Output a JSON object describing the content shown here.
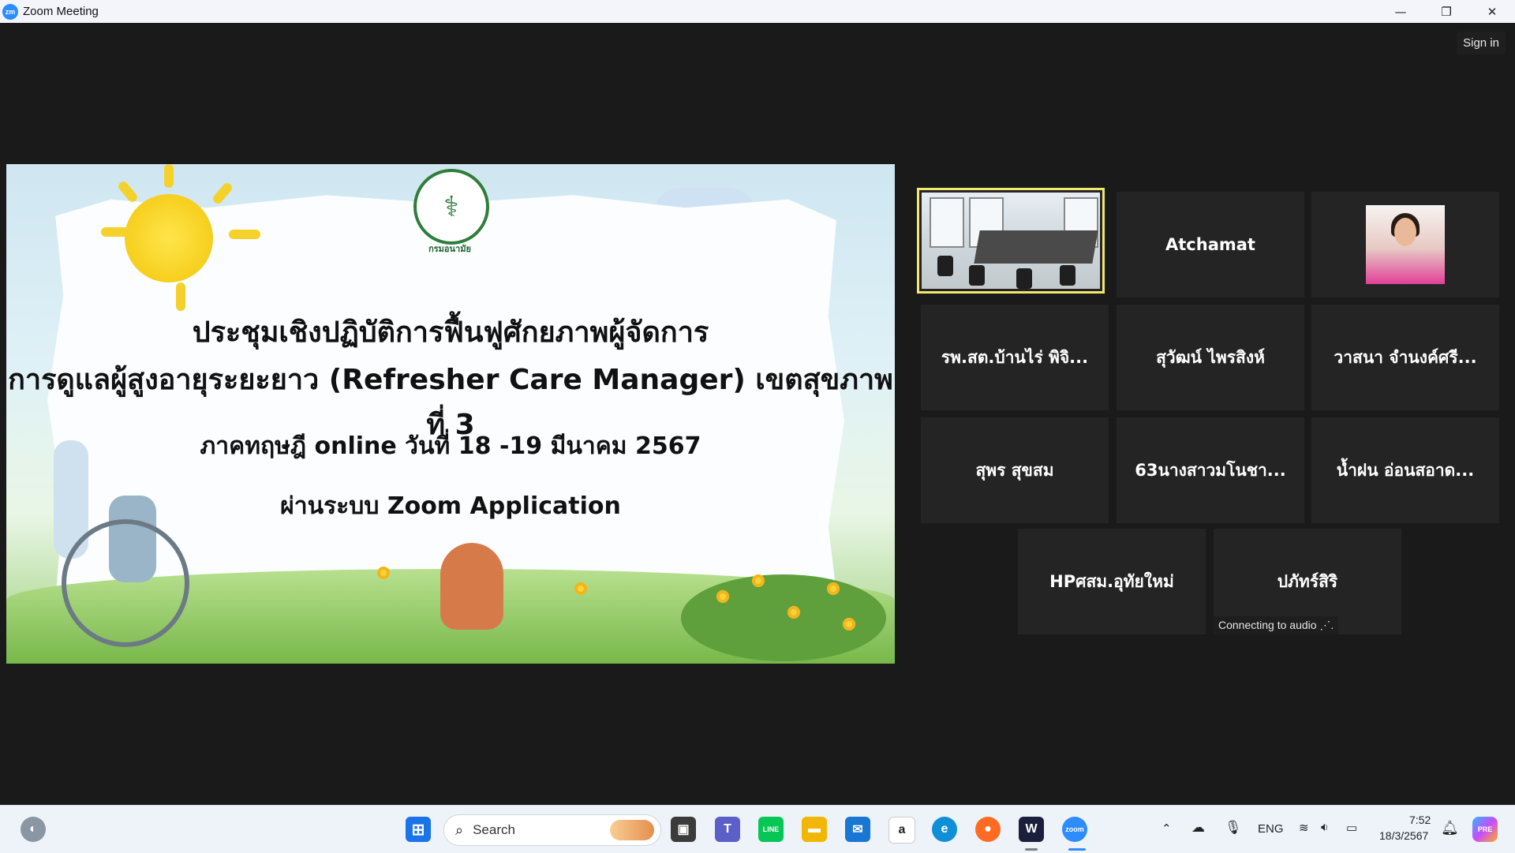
{
  "window": {
    "title": "Zoom Meeting",
    "app_icon_text": "zm",
    "controls": {
      "minimize": "—",
      "restore": "❐",
      "close": "✕"
    }
  },
  "meeting": {
    "sign_in_label": "Sign in"
  },
  "slide": {
    "logo_caption": "กรมอนามัย",
    "line1": "ประชุมเชิงปฏิบัติการฟื้นฟูศักยภาพผู้จัดการ",
    "line2": "การดูแลผู้สูงอายุระยะยาว (Refresher Care Manager) เขตสุขภาพที่ 3",
    "line3": "ภาคทฤษฎี online วันที่ 18 -19 มีนาคม 2567",
    "line4": "ผ่านระบบ Zoom Application"
  },
  "participants": [
    {
      "name": "",
      "type": "camera-room",
      "active": true
    },
    {
      "name": "Atchamat",
      "type": "name"
    },
    {
      "name": "",
      "type": "photo"
    },
    {
      "name": "รพ.สต.บ้านไร่ พิจิ...",
      "type": "name"
    },
    {
      "name": "สุวัฒน์ ไพรสิงห์",
      "type": "name"
    },
    {
      "name": "วาสนา  จำนงค์ศรี...",
      "type": "name"
    },
    {
      "name": "สุพร สุขสม",
      "type": "name"
    },
    {
      "name": "63นางสาวมโนชา...",
      "type": "name"
    },
    {
      "name": "น้ำฝน อ่อนสอาด...",
      "type": "name"
    },
    {
      "name": "HPศสม.อุทัยใหม่",
      "type": "name"
    },
    {
      "name": "ปภัทร์สิริ",
      "type": "name",
      "status": "Connecting to audio ⋰."
    }
  ],
  "taskbar": {
    "search_placeholder": "Search",
    "tray": {
      "language": "ENG",
      "time": "7:52",
      "date": "18/3/2567"
    },
    "icons": [
      {
        "name": "windows-start-icon",
        "glyph": "⊞",
        "color": "#1a73e8"
      },
      {
        "name": "task-view-icon",
        "glyph": "▣",
        "color": "#3b3b3b"
      },
      {
        "name": "teams-icon",
        "glyph": "T",
        "color": "#5b5fc7"
      },
      {
        "name": "line-icon",
        "glyph": "LINE",
        "color": "#06c755"
      },
      {
        "name": "file-explorer-icon",
        "glyph": "▬",
        "color": "#f2b705"
      },
      {
        "name": "mail-icon",
        "glyph": "✉",
        "color": "#1976d2"
      },
      {
        "name": "amazon-icon",
        "glyph": "a",
        "color": "#ffffff"
      },
      {
        "name": "edge-icon",
        "glyph": "e",
        "color": "#0f8fd8"
      },
      {
        "name": "firefox-icon",
        "glyph": "●",
        "color": "#ff6b22"
      },
      {
        "name": "wondershare-icon",
        "glyph": "W",
        "color": "#1b1f3b"
      },
      {
        "name": "zoom-icon",
        "glyph": "zoom",
        "color": "#2d8cff"
      }
    ]
  }
}
